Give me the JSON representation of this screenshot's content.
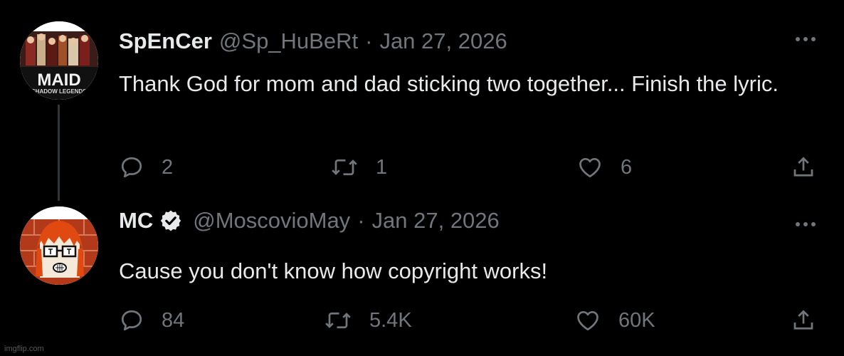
{
  "tweets": [
    {
      "display_name": "SpEnCer",
      "handle": "@Sp_HuBeRt",
      "separator": "·",
      "date": "Jan 27, 2026",
      "verified": false,
      "text": "Thank God for mom and dad sticking two together... Finish the lyric.",
      "avatar": {
        "icon": "maid-shadow-legends-avatar",
        "logo_text": "MAID",
        "logo_subtext": "SHADOW LEGENDS"
      },
      "stats": {
        "replies": "2",
        "retweets": "1",
        "likes": "6"
      }
    },
    {
      "display_name": "MC",
      "handle": "@MoscovioMay",
      "separator": "·",
      "date": "Jan 27, 2026",
      "verified": true,
      "text": "Cause you don't know how copyright works!",
      "avatar": {
        "icon": "cartoon-glasses-avatar"
      },
      "stats": {
        "replies": "84",
        "retweets": "5.4K",
        "likes": "60K"
      }
    }
  ],
  "icons": {
    "reply": "reply-icon",
    "retweet": "retweet-icon",
    "like": "heart-icon",
    "share": "share-icon",
    "more": "more-icon",
    "verified": "verified-badge-icon"
  },
  "colors": {
    "background": "#000000",
    "text_primary": "#e7e9ea",
    "text_secondary": "#71767b",
    "thread_line": "#333639"
  },
  "watermark": "imgflip.com"
}
